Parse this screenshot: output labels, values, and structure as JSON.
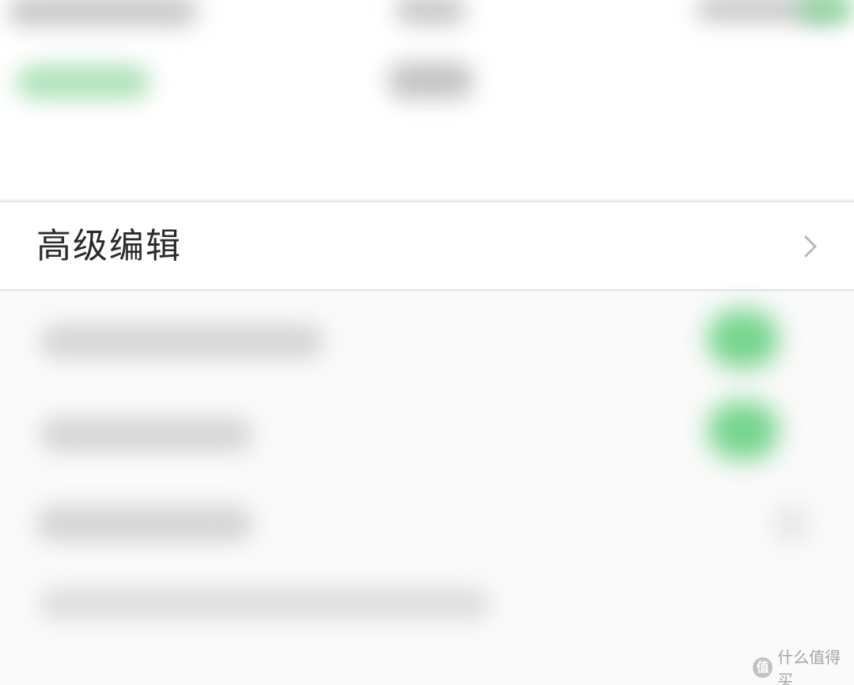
{
  "advanced_edit_row": {
    "label": "高级编辑",
    "chevron_icon": "chevron-right-icon"
  },
  "watermark": {
    "badge_glyph": "值",
    "text": "什么值得买"
  },
  "colors": {
    "switch_green": "#5fce7a",
    "text_primary": "#2b2b2b",
    "divider": "#e3e3e3",
    "chevron": "#b8b8b8"
  }
}
